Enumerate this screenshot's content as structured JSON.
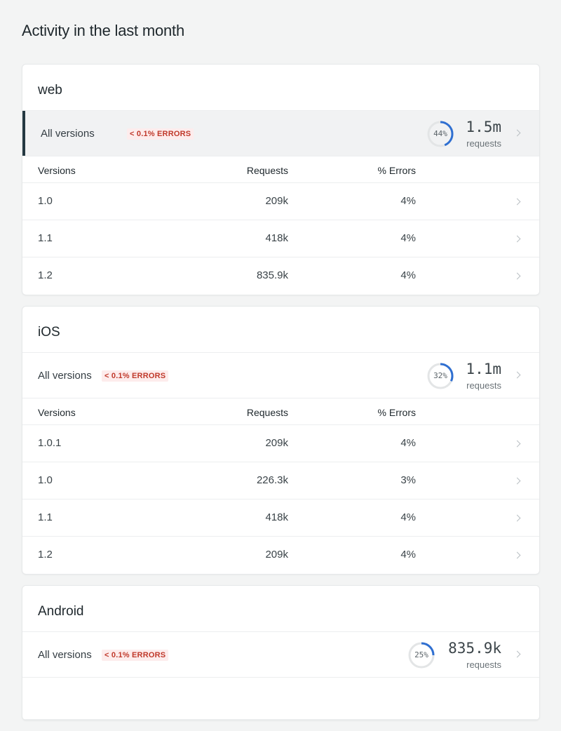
{
  "page": {
    "title": "Activity in the last month"
  },
  "table_headers": {
    "versions": "Versions",
    "requests": "Requests",
    "errors": "% Errors"
  },
  "colors": {
    "accent": "#2f6fd1",
    "error_text": "#c0392b",
    "error_bg": "#fdecec",
    "selected_bar": "#243841"
  },
  "platforms": [
    {
      "name": "web",
      "summary": {
        "label": "All versions",
        "badge": "< 0.1% ERRORS",
        "percent_text": "44%",
        "percent": 0.44,
        "requests": "1.5m",
        "requests_label": "requests",
        "selected": true
      },
      "rows": [
        {
          "version": "1.0",
          "requests": "209k",
          "errors": "4%"
        },
        {
          "version": "1.1",
          "requests": "418k",
          "errors": "4%"
        },
        {
          "version": "1.2",
          "requests": "835.9k",
          "errors": "4%"
        }
      ]
    },
    {
      "name": "iOS",
      "summary": {
        "label": "All versions",
        "badge": "< 0.1% ERRORS",
        "percent_text": "32%",
        "percent": 0.32,
        "requests": "1.1m",
        "requests_label": "requests",
        "selected": false
      },
      "rows": [
        {
          "version": "1.0.1",
          "requests": "209k",
          "errors": "4%"
        },
        {
          "version": "1.0",
          "requests": "226.3k",
          "errors": "3%"
        },
        {
          "version": "1.1",
          "requests": "418k",
          "errors": "4%"
        },
        {
          "version": "1.2",
          "requests": "209k",
          "errors": "4%"
        }
      ]
    },
    {
      "name": "Android",
      "summary": {
        "label": "All versions",
        "badge": "< 0.1% ERRORS",
        "percent_text": "25%",
        "percent": 0.25,
        "requests": "835.9k",
        "requests_label": "requests",
        "selected": false
      },
      "rows": []
    }
  ]
}
